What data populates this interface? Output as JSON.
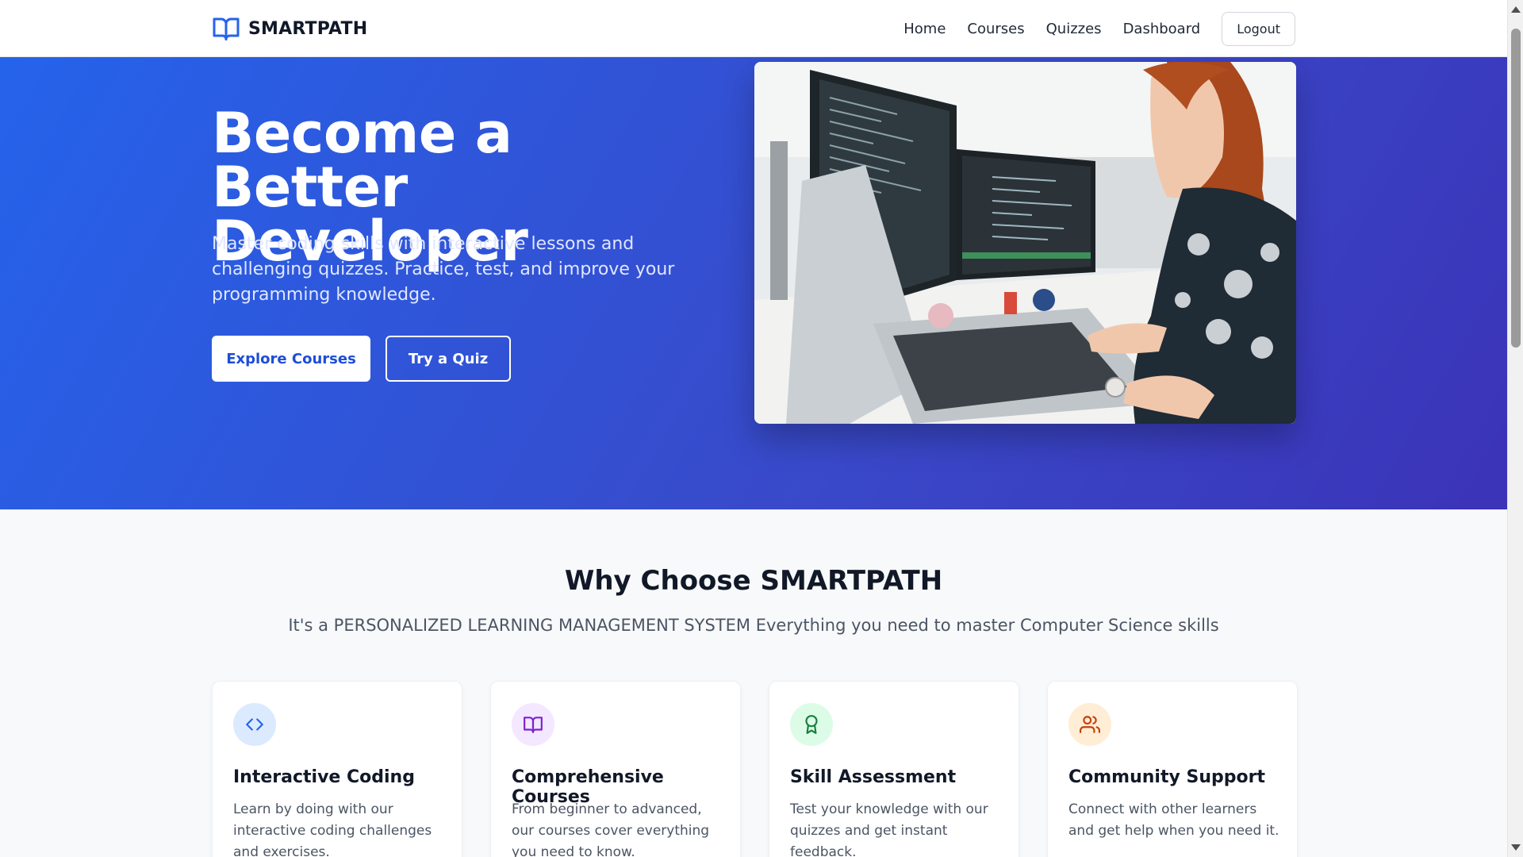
{
  "brand": {
    "name": "SMARTPATH",
    "icon": "open-book-icon"
  },
  "nav": {
    "items": [
      "Home",
      "Courses",
      "Quizzes",
      "Dashboard"
    ],
    "logout": "Logout"
  },
  "hero": {
    "title": "Become a Better Developer",
    "subtitle": "Master coding skills with interactive lessons and challenging quizzes. Practice, test, and improve your programming knowledge.",
    "primary_button": "Explore Courses",
    "secondary_button": "Try a Quiz",
    "image_alt": "developer-at-workstation-photo"
  },
  "features": {
    "title": "Why Choose SMARTPATH",
    "subtitle": "It's a PERSONALIZED LEARNING MANAGEMENT SYSTEM Everything you need to master Computer Science skills",
    "cards": [
      {
        "icon": "code-icon",
        "title": "Interactive Coding",
        "desc": "Learn by doing with our interactive coding challenges and exercises.",
        "color": "#2563eb",
        "bg": "#dbeafe"
      },
      {
        "icon": "book-open-icon",
        "title": "Comprehensive Courses",
        "desc": "From beginner to advanced, our courses cover everything you need to know.",
        "color": "#7e22ce",
        "bg": "#f3e8ff"
      },
      {
        "icon": "award-icon",
        "title": "Skill Assessment",
        "desc": "Test your knowledge with our quizzes and get instant feedback.",
        "color": "#15803d",
        "bg": "#dcfce7"
      },
      {
        "icon": "users-icon",
        "title": "Community Support",
        "desc": "Connect with other learners and get help when you need it.",
        "color": "#c2410c",
        "bg": "#ffedd5"
      }
    ]
  },
  "colors": {
    "accent": "#2563eb",
    "hero_gradient_end": "#3b33b8"
  }
}
